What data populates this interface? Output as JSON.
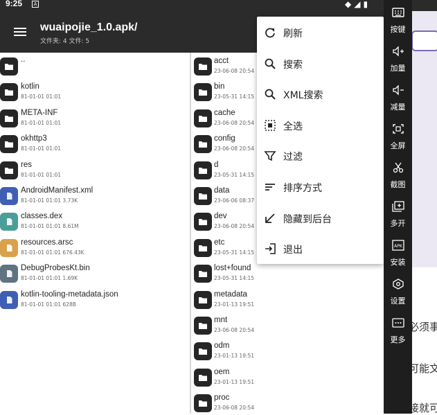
{
  "status_bar": {
    "time": "9:25",
    "indicator": "A"
  },
  "toolbar": {
    "title": "wuaipojie_1.0.apk/",
    "subtitle": "文件夹: 4  文件: 5"
  },
  "left_files": [
    {
      "name": "..",
      "meta": "",
      "icon": "folder-icon",
      "color": "#262626"
    },
    {
      "name": "kotlin",
      "meta": "81-01-01 01:01",
      "icon": "folder-icon",
      "color": "#262626"
    },
    {
      "name": "META-INF",
      "meta": "81-01-01 01:01",
      "icon": "folder-icon",
      "color": "#262626"
    },
    {
      "name": "okhttp3",
      "meta": "81-01-01 01:01",
      "icon": "folder-icon",
      "color": "#262626"
    },
    {
      "name": "res",
      "meta": "81-01-01 01:01",
      "icon": "folder-icon",
      "color": "#262626"
    },
    {
      "name": "AndroidManifest.xml",
      "meta": "81-01-01 01:01  3.73K",
      "icon": "xml-file-icon",
      "color": "#3f5fb5"
    },
    {
      "name": "classes.dex",
      "meta": "81-01-01 01:01  8.61M",
      "icon": "dex-file-icon",
      "color": "#4a9e99"
    },
    {
      "name": "resources.arsc",
      "meta": "81-01-01 01:01  676.43K",
      "icon": "arsc-file-icon",
      "color": "#d9a24a"
    },
    {
      "name": "DebugProbesKt.bin",
      "meta": "81-01-01 01:01  1.69K",
      "icon": "bin-file-icon",
      "color": "#5f7380"
    },
    {
      "name": "kotlin-tooling-metadata.json",
      "meta": "81-01-01 01:01  628B",
      "icon": "json-file-icon",
      "color": "#3f5fb5"
    }
  ],
  "right_files": [
    {
      "name": "acct",
      "meta": "23-06-08 20:54"
    },
    {
      "name": "bin",
      "meta": "23-05-31 14:15"
    },
    {
      "name": "cache",
      "meta": "23-06-08 20:54"
    },
    {
      "name": "config",
      "meta": "23-06-08 20:54"
    },
    {
      "name": "d",
      "meta": "23-05-31 14:15"
    },
    {
      "name": "data",
      "meta": "23-06-06 08:37"
    },
    {
      "name": "dev",
      "meta": "23-06-08 20:54"
    },
    {
      "name": "etc",
      "meta": "23-05-31 14:15"
    },
    {
      "name": "lost+found",
      "meta": "23-05-31 14:15"
    },
    {
      "name": "metadata",
      "meta": "23-01-13 19:51"
    },
    {
      "name": "mnt",
      "meta": "23-06-08 20:54"
    },
    {
      "name": "odm",
      "meta": "23-01-13 19:51"
    },
    {
      "name": "oem",
      "meta": "23-01-13 19:51"
    },
    {
      "name": "proc",
      "meta": "23-06-08 20:54"
    }
  ],
  "menu": [
    {
      "label": "刷新",
      "icon": "refresh-icon"
    },
    {
      "label": "搜索",
      "icon": "search-icon"
    },
    {
      "label": "XML搜索",
      "icon": "xml-search-icon"
    },
    {
      "label": "全选",
      "icon": "select-all-icon"
    },
    {
      "label": "过滤",
      "icon": "filter-icon"
    },
    {
      "label": "排序方式",
      "icon": "sort-icon"
    },
    {
      "label": "隐藏到后台",
      "icon": "hide-to-background-icon"
    },
    {
      "label": "退出",
      "icon": "exit-icon"
    }
  ],
  "sidebar": [
    {
      "label": "按键",
      "icon": "keyboard-icon"
    },
    {
      "label": "加量",
      "icon": "volume-up-icon"
    },
    {
      "label": "减量",
      "icon": "volume-down-icon"
    },
    {
      "label": "全屏",
      "icon": "fullscreen-icon"
    },
    {
      "label": "截图",
      "icon": "screenshot-icon"
    },
    {
      "label": "多开",
      "icon": "multi-open-icon"
    },
    {
      "label": "安装",
      "icon": "apk-install-icon"
    },
    {
      "label": "设置",
      "icon": "settings-icon"
    },
    {
      "label": "更多",
      "icon": "more-icon"
    }
  ],
  "background_text": [
    "必须事",
    "可能文",
    "接就可"
  ]
}
